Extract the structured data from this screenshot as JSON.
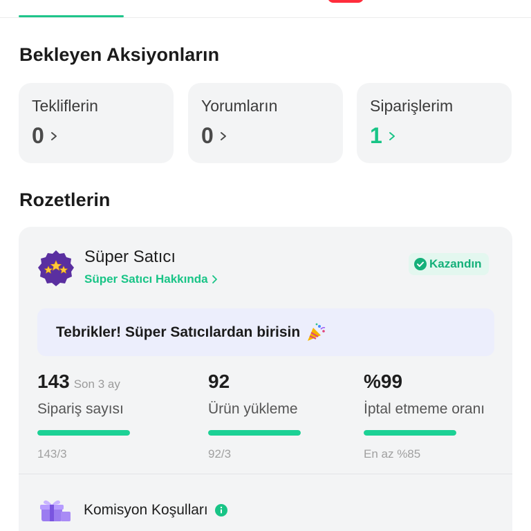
{
  "pending": {
    "title": "Bekleyen Aksiyonların",
    "cards": [
      {
        "label": "Tekliflerin",
        "count": "0"
      },
      {
        "label": "Yorumların",
        "count": "0"
      },
      {
        "label": "Siparişlerim",
        "count": "1"
      }
    ]
  },
  "badges": {
    "title": "Rozetlerin",
    "badge": {
      "name": "Süper Satıcı",
      "link": "Süper Satıcı Hakkında",
      "status": "Kazandın",
      "congrats": "Tebrikler! Süper Satıcılardan birisin",
      "metrics": [
        {
          "value": "143",
          "sub": "Son 3 ay",
          "label": "Sipariş sayısı",
          "target": "143/3",
          "progress": 1.0
        },
        {
          "value": "92",
          "sub": "",
          "label": "Ürün yükleme",
          "target": "92/3",
          "progress": 1.0
        },
        {
          "value": "%99",
          "sub": "",
          "label": "İptal etmeme oranı",
          "target": "En az %85",
          "progress": 1.0
        }
      ]
    },
    "commission": {
      "title": "Komisyon Koşulları"
    }
  },
  "colors": {
    "accent": "#18c486",
    "tab_indicator": "#1fc58b",
    "badge_purple": "#5a2fa0",
    "congrats_bg": "#eceefc"
  },
  "icons": {
    "chevron": "chevron-right-icon",
    "badge": "super-seller-stars-icon",
    "check": "check-circle-icon",
    "party": "party-popper-icon",
    "gift": "gift-box-icon",
    "info": "info-icon"
  }
}
